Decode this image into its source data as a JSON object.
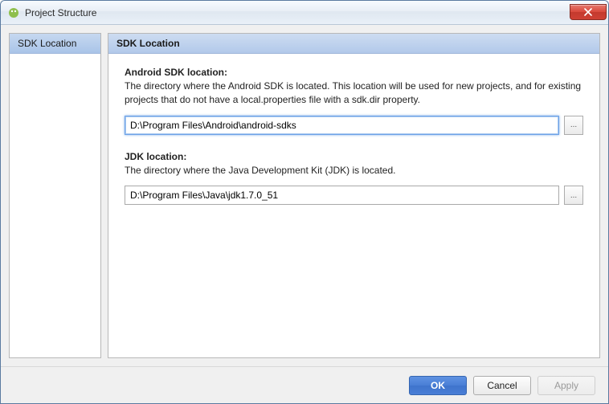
{
  "window": {
    "title": "Project Structure"
  },
  "sidebar": {
    "items": [
      {
        "label": "SDK Location",
        "selected": true
      }
    ]
  },
  "main": {
    "header": "SDK Location",
    "sections": {
      "android_sdk": {
        "title": "Android SDK location:",
        "desc": "The directory where the Android SDK is located. This location will be used for new projects, and for existing projects that do not have a local.properties file with a sdk.dir property.",
        "value": "D:\\Program Files\\Android\\android-sdks",
        "browse_label": "..."
      },
      "jdk": {
        "title": "JDK location:",
        "desc": "The directory where the Java Development Kit (JDK) is located.",
        "value": "D:\\Program Files\\Java\\jdk1.7.0_51",
        "browse_label": "..."
      }
    }
  },
  "footer": {
    "ok": "OK",
    "cancel": "Cancel",
    "apply": "Apply"
  }
}
